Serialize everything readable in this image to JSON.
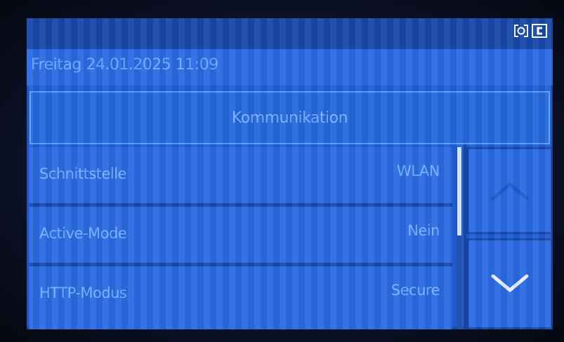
{
  "status_icons": [
    "camera-icon",
    "c-badge-icon"
  ],
  "header": {
    "datetime": "Freitag 24.01.2025 11:09"
  },
  "title": {
    "label": "Kommunikation"
  },
  "settings": [
    {
      "label": "Schnittstelle",
      "value": "WLAN"
    },
    {
      "label": "Active-Mode",
      "value": "Nein"
    },
    {
      "label": "HTTP-Modus",
      "value": "Secure"
    }
  ],
  "navigation": {
    "up_icon": "chevron-up-icon",
    "down_icon": "chevron-down-icon"
  },
  "colors": {
    "screen": "#1f5fd6",
    "text": "#7ab0ff",
    "separator": "#1848a8"
  },
  "scroll": {
    "position_fraction": 0.0
  }
}
